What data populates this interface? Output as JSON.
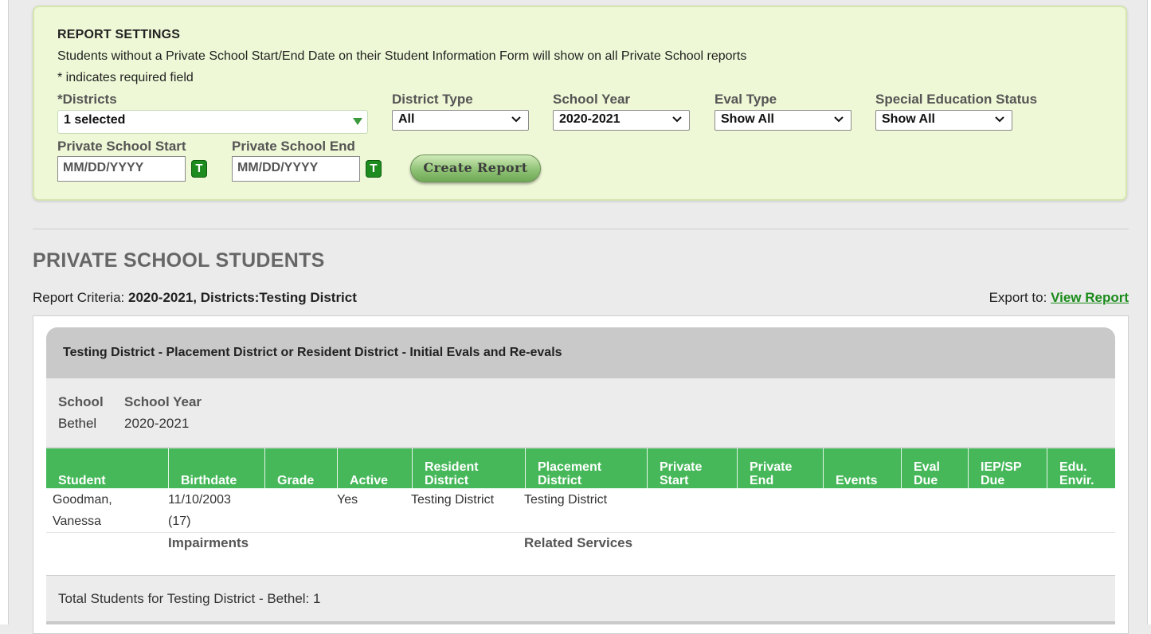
{
  "settings": {
    "title": "REPORT SETTINGS",
    "note": "Students without a Private School Start/End Date on their Student Information Form will show on all Private School reports",
    "required_note": "* indicates required field",
    "districts": {
      "label_star": "*",
      "label": "Districts",
      "value": "1 selected"
    },
    "district_type": {
      "label": "District Type",
      "value": "All"
    },
    "school_year": {
      "label": "School Year",
      "value": "2020-2021"
    },
    "eval_type": {
      "label": "Eval Type",
      "value": "Show All"
    },
    "sped_status": {
      "label": "Special Education Status",
      "value": "Show All"
    },
    "ps_start": {
      "label": "Private School Start",
      "placeholder": "MM/DD/YYYY",
      "today_label": "T"
    },
    "ps_end": {
      "label": "Private School End",
      "placeholder": "MM/DD/YYYY",
      "today_label": "T"
    },
    "create_button": "Create Report"
  },
  "report": {
    "section_title": "PRIVATE SCHOOL STUDENTS",
    "criteria_label": "Report Criteria: ",
    "criteria_value": "2020-2021, Districts:Testing District",
    "export_label": "Export to: ",
    "export_link": "View Report",
    "group_title": "Testing District - Placement District or Resident District - Initial Evals and Re-evals",
    "school_header": {
      "school": "School",
      "year": "School Year"
    },
    "school_values": {
      "school": "Bethel",
      "year": "2020-2021"
    },
    "columns": {
      "student": "Student",
      "birthdate": "Birthdate",
      "grade": "Grade",
      "active": "Active",
      "resident_1": "Resident",
      "resident_2": "District",
      "placement_1": "Placement",
      "placement_2": "District",
      "pstart_1": "Private",
      "pstart_2": "Start",
      "pend_1": "Private",
      "pend_2": "End",
      "events": "Events",
      "evaldue_1": "Eval",
      "evaldue_2": "Due",
      "iep_1": "IEP/SP",
      "iep_2": "Due",
      "edu_1": "Edu.",
      "edu_2": "Envir."
    },
    "rows": [
      {
        "student_1": "Goodman,",
        "student_2": "Vanessa",
        "birthdate": "11/10/2003",
        "age": "(17)",
        "grade": "",
        "active": "Yes",
        "resident_district": "Testing District",
        "placement_district": "Testing District"
      }
    ],
    "sub_labels": {
      "impairments": "Impairments",
      "related_services": "Related Services"
    },
    "total": "Total Students for Testing District - Bethel: 1"
  },
  "colors": {
    "accent_green": "#46b85a",
    "link_green": "#1a8b1a",
    "panel_bg": "#eef8d6"
  }
}
